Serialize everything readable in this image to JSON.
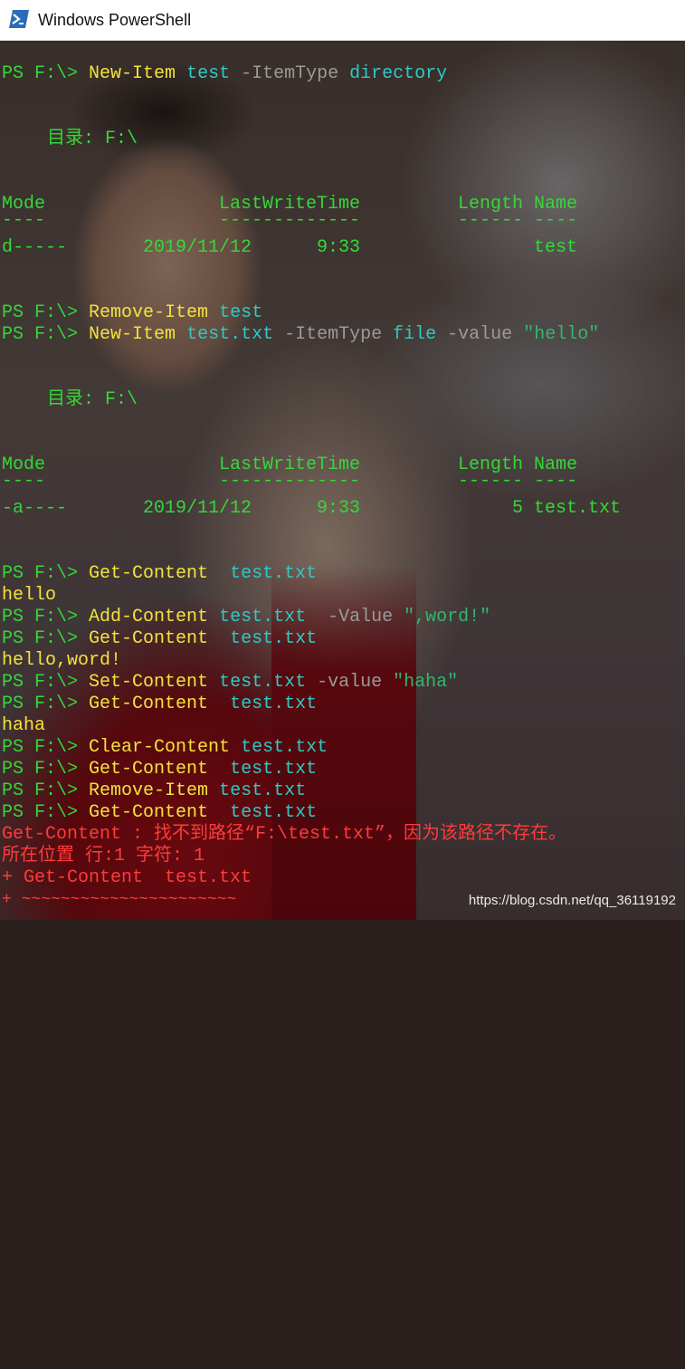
{
  "window": {
    "title": "Windows PowerShell",
    "icon": "powershell-icon"
  },
  "console": {
    "prompt": "PS F:\\>",
    "cmd1": {
      "verb": "New-Item",
      "arg": "test",
      "param": "-ItemType",
      "value": "directory"
    },
    "dir_label_1": "目录: F:\\",
    "table1": {
      "headers": {
        "mode": "Mode",
        "time": "LastWriteTime",
        "length": "Length",
        "name": "Name"
      },
      "rules": {
        "mode": "----",
        "time": "-------------",
        "length": "------",
        "name": "----"
      },
      "row": {
        "mode": "d-----",
        "date": "2019/11/12",
        "time": "9:33",
        "length": "",
        "name": "test"
      }
    },
    "cmd2": {
      "verb": "Remove-Item",
      "arg": "test"
    },
    "cmd3": {
      "verb": "New-Item",
      "arg": "test.txt",
      "param1": "-ItemType",
      "value1": "file",
      "param2": "-value",
      "value2": "\"hello\""
    },
    "dir_label_2": "目录: F:\\",
    "table2": {
      "headers": {
        "mode": "Mode",
        "time": "LastWriteTime",
        "length": "Length",
        "name": "Name"
      },
      "rules": {
        "mode": "----",
        "time": "-------------",
        "length": "------",
        "name": "----"
      },
      "row": {
        "mode": "-a----",
        "date": "2019/11/12",
        "time": "9:33",
        "length": "5",
        "name": "test.txt"
      }
    },
    "cmd4": {
      "verb": "Get-Content",
      "arg": "test.txt"
    },
    "out4": "hello",
    "cmd5": {
      "verb": "Add-Content",
      "arg": "test.txt",
      "param": "-Value",
      "value": "\",word!\""
    },
    "cmd6": {
      "verb": "Get-Content",
      "arg": "test.txt"
    },
    "out6": "hello,word!",
    "cmd7": {
      "verb": "Set-Content",
      "arg": "test.txt",
      "param": "-value",
      "value": "\"haha\""
    },
    "cmd8": {
      "verb": "Get-Content",
      "arg": "test.txt"
    },
    "out8": "haha",
    "cmd9": {
      "verb": "Clear-Content",
      "arg": "test.txt"
    },
    "cmd10": {
      "verb": "Get-Content",
      "arg": "test.txt"
    },
    "cmd11": {
      "verb": "Remove-Item",
      "arg": "test.txt"
    },
    "cmd12": {
      "verb": "Get-Content",
      "arg": "test.txt"
    },
    "error": {
      "line1": "Get-Content : 找不到路径“F:\\test.txt”，因为该路径不存在。",
      "line2": "所在位置 行:1 字符: 1",
      "line3": "+ Get-Content  test.txt",
      "line4": "+ ~~~~~~~~~~~~~~~~~~~~~~"
    }
  },
  "watermark": "https://blog.csdn.net/qq_36119192"
}
